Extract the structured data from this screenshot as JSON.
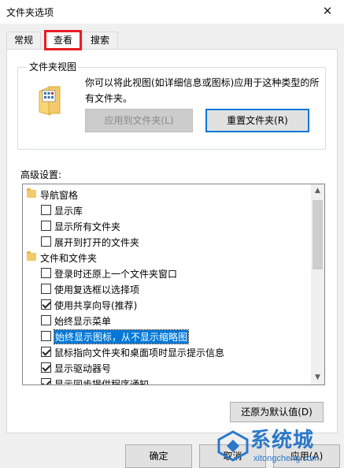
{
  "window": {
    "title": "文件夹选项",
    "close_glyph": "✕"
  },
  "tabs": [
    {
      "label": "常规"
    },
    {
      "label": "查看"
    },
    {
      "label": "搜索"
    }
  ],
  "folder_views": {
    "group_title": "文件夹视图",
    "description": "你可以将此视图(如详细信息或图标)应用于这种类型的所有文件夹。",
    "apply_button": "应用到文件夹(L)",
    "reset_button": "重置文件夹(R)"
  },
  "advanced": {
    "label": "高级设置:",
    "items": [
      {
        "type": "folder",
        "label": "导航窗格"
      },
      {
        "type": "checkbox",
        "label": "显示库",
        "checked": false
      },
      {
        "type": "checkbox",
        "label": "显示所有文件夹",
        "checked": false
      },
      {
        "type": "checkbox",
        "label": "展开到打开的文件夹",
        "checked": false
      },
      {
        "type": "folder",
        "label": "文件和文件夹"
      },
      {
        "type": "checkbox",
        "label": "登录时还原上一个文件夹窗口",
        "checked": false
      },
      {
        "type": "checkbox",
        "label": "使用复选框以选择项",
        "checked": false
      },
      {
        "type": "checkbox",
        "label": "使用共享向导(推荐)",
        "checked": true
      },
      {
        "type": "checkbox",
        "label": "始终显示菜单",
        "checked": false
      },
      {
        "type": "checkbox",
        "label": "始终显示图标，从不显示缩略图",
        "checked": false,
        "selected": true
      },
      {
        "type": "checkbox",
        "label": "鼠标指向文件夹和桌面项时显示提示信息",
        "checked": true
      },
      {
        "type": "checkbox",
        "label": "显示驱动器号",
        "checked": true
      },
      {
        "type": "checkbox",
        "label": "显示同步提供程序通知",
        "checked": true
      }
    ]
  },
  "buttons": {
    "restore_defaults": "还原为默认值(D)",
    "ok": "确定",
    "cancel": "取消",
    "apply": "应用(A)"
  },
  "watermark": {
    "brand": "系统城",
    "url": "xitongcheng.com"
  },
  "colors": {
    "accent": "#0078d7",
    "highlight_box": "#e81e25",
    "watermark": "#2b78c9"
  },
  "icons": {
    "close": "close-icon",
    "folder": "folder-icon",
    "folder_view": "folder-view-icon",
    "scroll_up": "scroll-up-arrow-icon",
    "scroll_down": "scroll-down-arrow-icon"
  }
}
